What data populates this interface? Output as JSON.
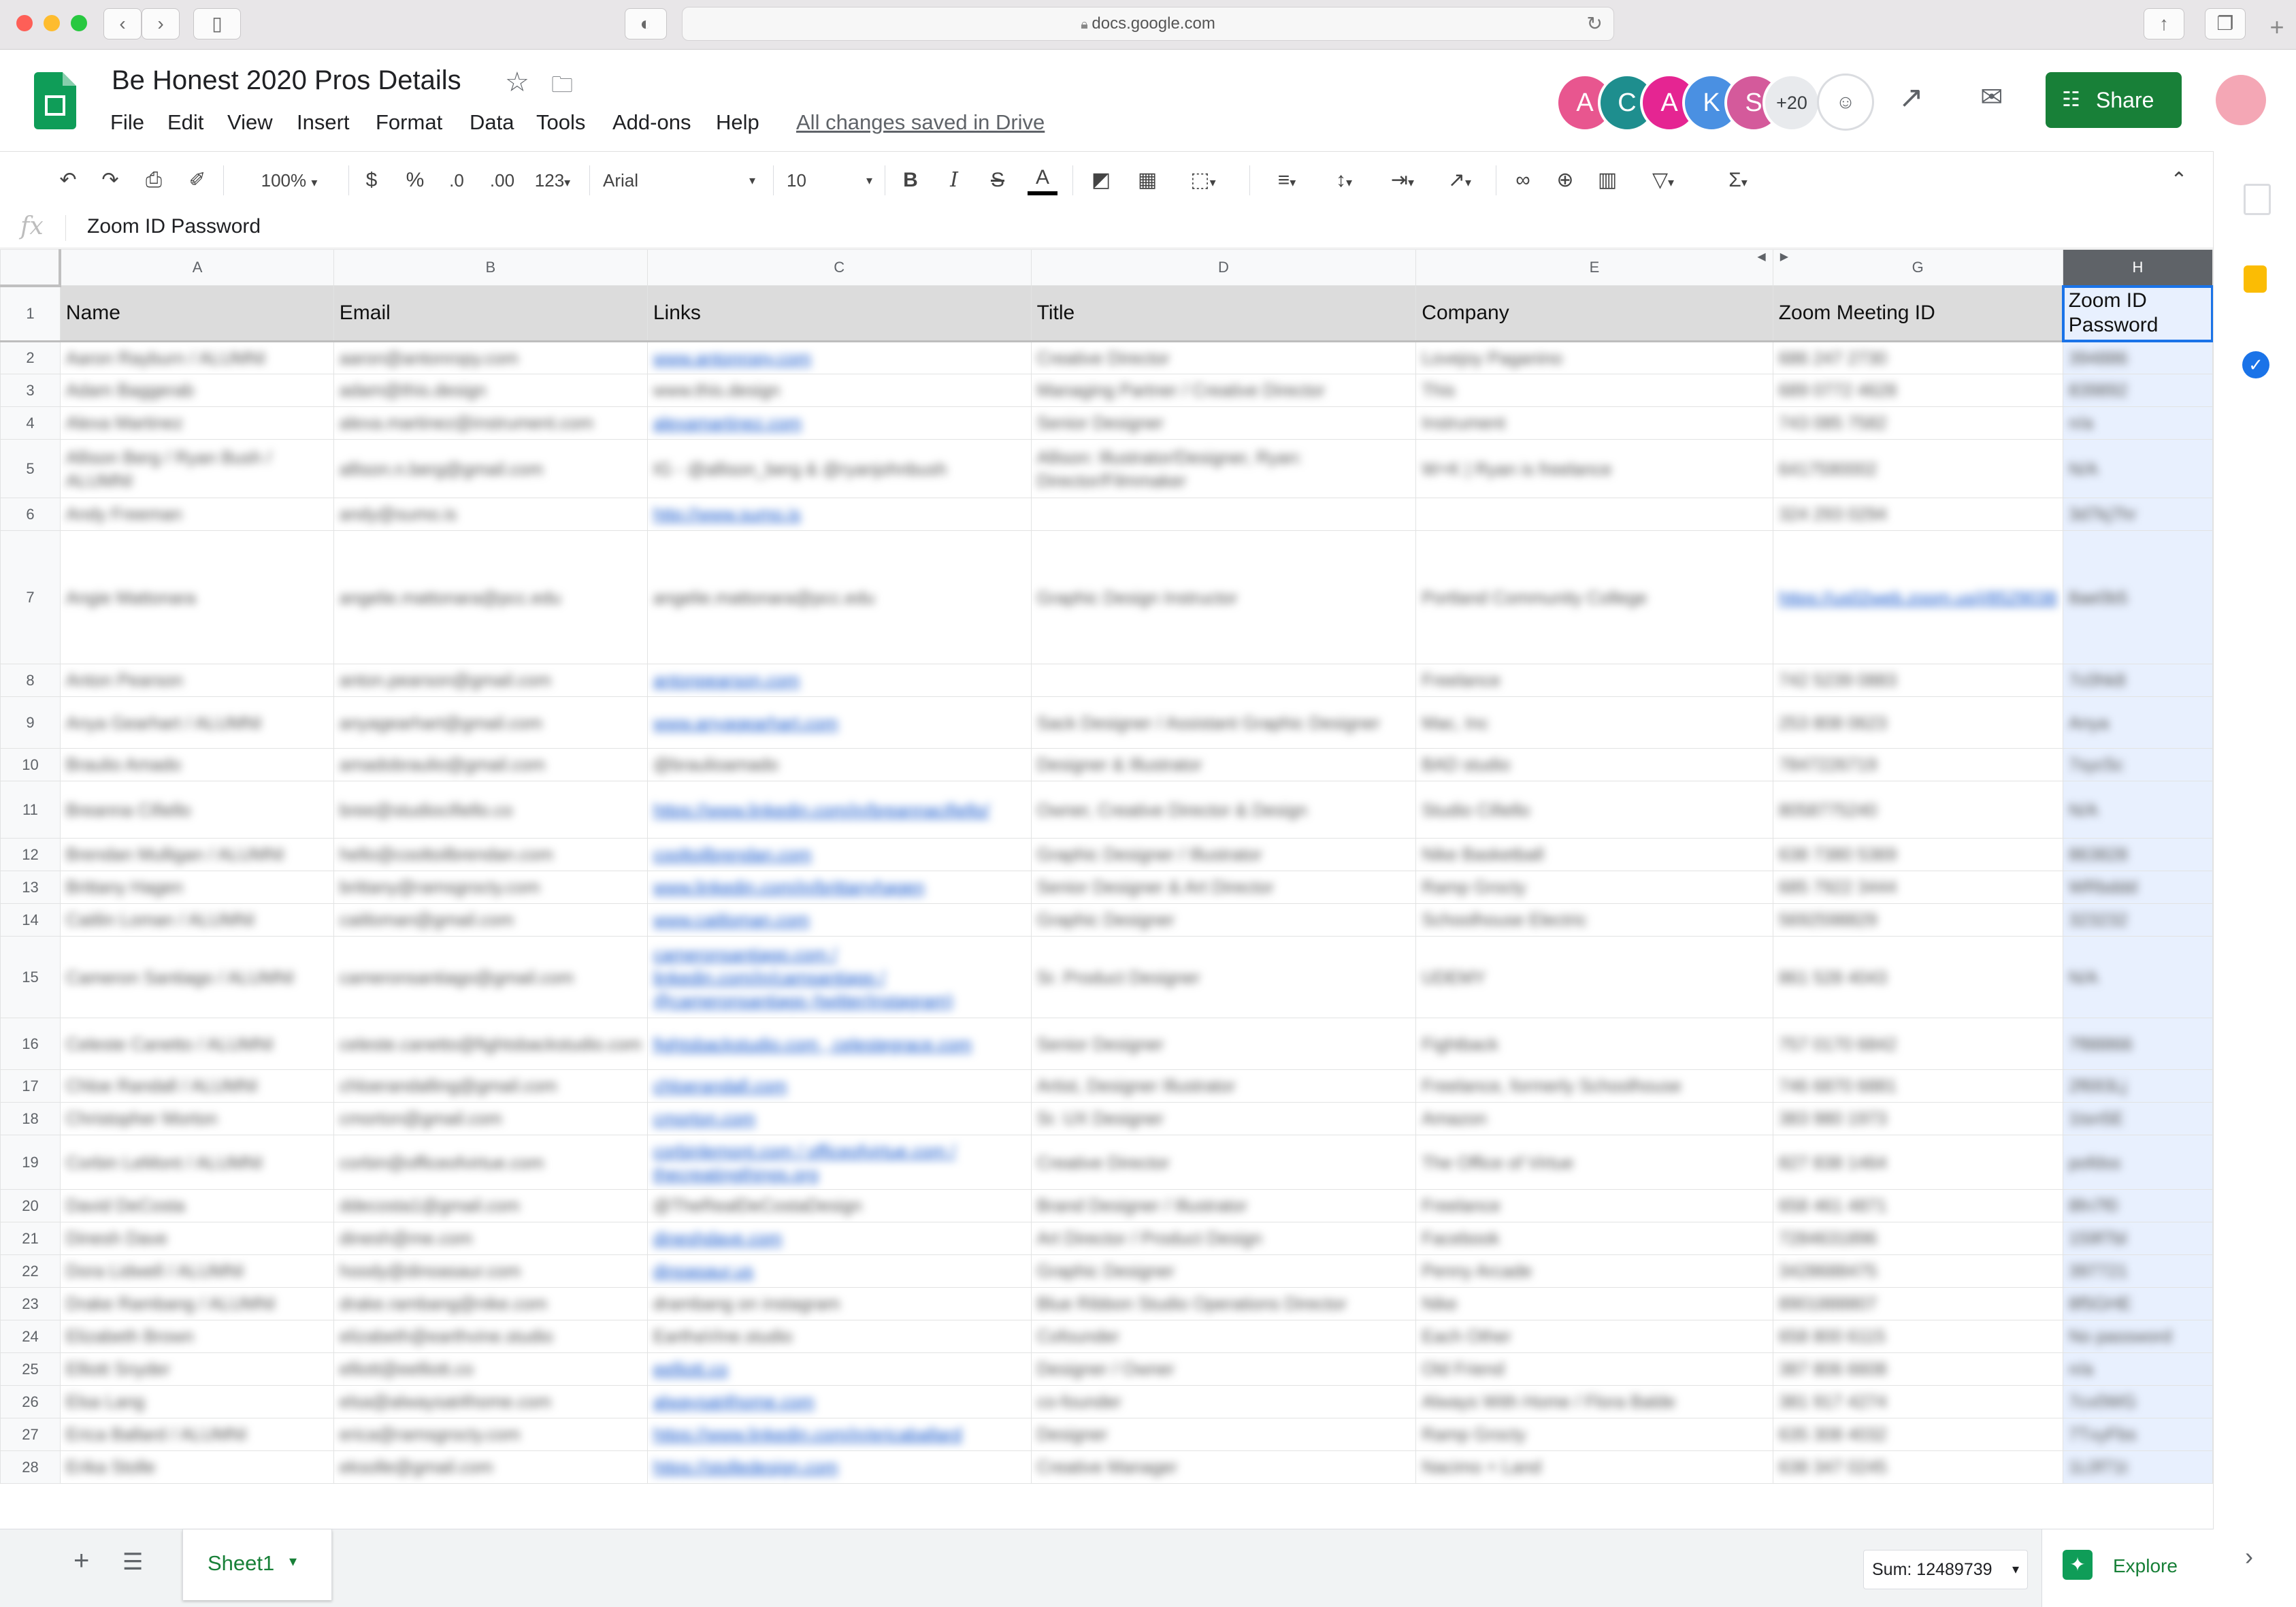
{
  "browser": {
    "url": "docs.google.com",
    "back_icon": "chevron-left-icon",
    "forward_icon": "chevron-right-icon"
  },
  "doc": {
    "title": "Be Honest 2020 Pros Details",
    "save_status": "All changes saved in Drive",
    "menu": [
      "File",
      "Edit",
      "View",
      "Insert",
      "Format",
      "Data",
      "Tools",
      "Add-ons",
      "Help"
    ]
  },
  "collaborators": {
    "avatars": [
      {
        "letter": "A",
        "color": "#e8568f"
      },
      {
        "letter": "C",
        "color": "#1e8e8e"
      },
      {
        "letter": "A",
        "color": "#e52592"
      },
      {
        "letter": "K",
        "color": "#4a90e2"
      },
      {
        "letter": "S",
        "color": "#d45a9b"
      }
    ],
    "more": "+20"
  },
  "share_label": "Share",
  "toolbar": {
    "zoom": "100%",
    "currency": "$",
    "percent": "%",
    "dec_decrease": ".0",
    "dec_increase": ".00",
    "more_formats": "123",
    "font": "Arial",
    "font_size": "10",
    "bold": "B",
    "italic": "I",
    "strike": "S",
    "text_color": "A"
  },
  "formula": {
    "fx": "fx",
    "value": "Zoom ID Password"
  },
  "grid": {
    "columns": [
      "A",
      "B",
      "C",
      "D",
      "E",
      "G",
      "H"
    ],
    "headers": [
      "Name",
      "Email",
      "Links",
      "Title",
      "Company",
      "Zoom Meeting ID",
      "Zoom ID\nPassword"
    ],
    "rows": [
      {
        "n": "2",
        "h": 48,
        "c": [
          "Aaron Rayburn / ALUMNI",
          "aaron@antonropy.com",
          "www.antonropy.com",
          "Creative Director",
          "Lovejoy Paganino",
          "686 247 2730",
          "394886"
        ],
        "links": [
          2
        ]
      },
      {
        "n": "3",
        "h": 48,
        "c": [
          "Adam Baggerab",
          "adam@this.design",
          "www.this.design",
          "Managing Partner / Creative Director",
          "This",
          "689 0772 4628",
          "839892"
        ],
        "links": []
      },
      {
        "n": "4",
        "h": 48,
        "c": [
          "Alexa Martinez",
          "alexa.martinez@instrument.com",
          "alexamartinez.com",
          "Senior Designer",
          "Instrument",
          "743 085 7582",
          "n/a"
        ],
        "links": [
          2
        ]
      },
      {
        "n": "5",
        "h": 86,
        "c": [
          "Allison Berg / Ryan Bush / ALUMNI",
          "allison.n.berg@gmail.com",
          "IG - @allison_berg & @ryanjohnbush",
          "Allison: Illustrator/Designer, Ryan: Director/Filmmaker",
          "W+K | Ryan is freelance",
          "6417590002",
          "N/A"
        ],
        "links": []
      },
      {
        "n": "6",
        "h": 48,
        "c": [
          "Andy Freeman",
          "andy@sumo.is",
          "http://www.sumo.is",
          "",
          "",
          "324 293 0294",
          "3d7kj7hr"
        ],
        "links": [
          2
        ]
      },
      {
        "n": "7",
        "h": 196,
        "c": [
          "Angie Mattonara",
          "angelie.mattonara@pcc.edu",
          "angelie.mattonara@pcc.edu",
          "Graphic Design Instructor",
          "Portland Community College",
          "https://us02web.zoom.us/j/8529038",
          "8ae0b5"
        ],
        "links": [
          5
        ]
      },
      {
        "n": "8",
        "h": 48,
        "c": [
          "Anton Pearson",
          "anton.pearson@gmail.com",
          "antonpearson.com",
          "",
          "Freelance",
          "742 5239 0883",
          "7c0hk8"
        ],
        "links": [
          2
        ]
      },
      {
        "n": "9",
        "h": 76,
        "c": [
          "Anya Gearhart / ALUMNI",
          "anyagearhart@gmail.com",
          "www.anyagearhart.com",
          "Sack Designer / Assistant Graphic Designer",
          "Mac, Inc",
          "253 808 0623",
          "Anya"
        ],
        "links": [
          2
        ]
      },
      {
        "n": "10",
        "h": 48,
        "c": [
          "Braulio Amado",
          "amadobraulio@gmail.com",
          "@braulioamado",
          "Designer & Illustrator",
          "BAD studio",
          "7847226719",
          "7syc5c"
        ],
        "links": []
      },
      {
        "n": "11",
        "h": 84,
        "c": [
          "Breanna Cifiello",
          "bree@studiocifiello.co",
          "https://www.linkedin.com/in/breannacifiello/",
          "Owner, Creative Director & Design",
          "Studio Cifiello",
          "8058775240",
          "N/A"
        ],
        "links": [
          2
        ]
      },
      {
        "n": "12",
        "h": 48,
        "c": [
          "Brendan Mulligan / ALUMNI",
          "hello@cooltoilbrendan.com",
          "cooltoilbrendan.com",
          "Graphic Designer / Illustrator",
          "Nike Basketball",
          "638 7380 5369",
          "863828"
        ],
        "links": [
          2
        ]
      },
      {
        "n": "13",
        "h": 48,
        "c": [
          "Brittany Hagen",
          "brittany@ramsgrocty.com",
          "www.linkedin.com/in/brittanyhagen",
          "Senior Designer & Art Director",
          "Ramp Grocty",
          "685 7922 3444",
          "WRbddd"
        ],
        "links": [
          2
        ]
      },
      {
        "n": "14",
        "h": 48,
        "c": [
          "Caitlin Loman / ALUMNI",
          "caitloman@gmail.com",
          "www.caitloman.com",
          "Graphic Designer",
          "Schoolhouse Electric",
          "5692598829",
          "323232"
        ],
        "links": [
          2
        ]
      },
      {
        "n": "15",
        "h": 120,
        "c": [
          "Cameron Santiago / ALUMNI",
          "cameronsantiago@gmail.com",
          "cameronsantiago.com / linkedin.com/in/camsantiago / @cameronsantiago (twitter/instagram)",
          "Sr. Product Designer",
          "UDEMY",
          "861 528 4043",
          "N/A"
        ],
        "links": [
          2
        ]
      },
      {
        "n": "16",
        "h": 76,
        "c": [
          "Celeste Canetto / ALUMNI",
          "celeste.canetto@fightsbackstudio.com",
          "fightsbackstudio.com , celestegrace.com",
          "Senior Designer",
          "Fightback",
          "757 0170 6842",
          "7f88866"
        ],
        "links": [
          2
        ]
      },
      {
        "n": "17",
        "h": 48,
        "c": [
          "Chloe Randall / ALUMNI",
          "chloerandalling@gmail.com",
          "chloerandall.com",
          "Artist, Designer Illustrator",
          "Freelance, formerly Schoolhouse",
          "746 6870 6881",
          "2f693Lj"
        ],
        "links": [
          2
        ]
      },
      {
        "n": "18",
        "h": 48,
        "c": [
          "Christopher Morton",
          "cmorton@gmail.com",
          "cmorton.com",
          "Sr. UX Designer",
          "Amazon",
          "383 980 1973",
          "1tsn5E"
        ],
        "links": [
          2
        ]
      },
      {
        "n": "19",
        "h": 80,
        "c": [
          "Corbin LeMont / ALUMNI",
          "corbin@officeofvirtue.com",
          "corbinlemont.com / officeofvirtue.com / thecreatingthings.org",
          "Creative Director",
          "The Office of Virtue",
          "827 838 1464",
          "pofdss"
        ],
        "links": [
          2
        ]
      },
      {
        "n": "20",
        "h": 48,
        "c": [
          "David DeCosta",
          "ddecosta1@gmail.com",
          "@TheRealDeCostaDesign",
          "Brand Designer / Illustrator",
          "Freelance",
          "658 461 4871",
          "8fn7f0"
        ],
        "links": []
      },
      {
        "n": "21",
        "h": 48,
        "c": [
          "Dinesh Dave",
          "dinesh@me.com",
          "dineshdave.com",
          "Art Director / Product Design",
          "Facebook",
          "7284631896",
          "159f7bl"
        ],
        "links": [
          2
        ]
      },
      {
        "n": "22",
        "h": 48,
        "c": [
          "Dora Lidwell / ALUMNI",
          "hoody@dinoasaur.com",
          "dinoasaur.us",
          "Graphic Designer",
          "Penny Arcade",
          "3428688475",
          "397721"
        ],
        "links": [
          2
        ]
      },
      {
        "n": "23",
        "h": 48,
        "c": [
          "Drake Rambang / ALUMNI",
          "drake.rambang@nike.com",
          "drambang on instagram",
          "Blue Ribbon Studio Operations Director",
          "Nike",
          "8901888807",
          "8f5GHE"
        ],
        "links": []
      },
      {
        "n": "24",
        "h": 48,
        "c": [
          "Elizabeth Brown",
          "elizabeth@earthvine.studio",
          "EarthaVine.studio",
          "Cofounder",
          "Each Other",
          "658 800 6115",
          "No password"
        ],
        "links": []
      },
      {
        "n": "25",
        "h": 48,
        "c": [
          "Elliott Snyder",
          "elliott@eelliott.co",
          "eelliott.co",
          "Designer / Owner",
          "Old Friend",
          "387 806 6608",
          "n/a"
        ],
        "links": [
          2
        ]
      },
      {
        "n": "26",
        "h": 48,
        "c": [
          "Elsa Lang",
          "elsa@alwaysat4home.com",
          "alwaysat4home.com",
          "co-founder",
          "Always With Home / Flora Balde",
          "381 917 4274",
          "7cv0WG"
        ],
        "links": [
          2
        ]
      },
      {
        "n": "27",
        "h": 48,
        "c": [
          "Erica Ballard / ALUMNI",
          "erica@ramsgrocty.com",
          "https://www.linkedin.com/in/ericaballard",
          "Designer",
          "Ramp Grocty",
          "635 308 4032",
          "7TxyFbs"
        ],
        "links": [
          2
        ]
      },
      {
        "n": "28",
        "h": 48,
        "c": [
          "Erika Stolle",
          "eksolle@gmail.com",
          "https://stolledesign.com",
          "Creative Manager",
          "Nacimo + Land",
          "638 347 0245",
          "1L0f71t"
        ],
        "links": [
          2
        ]
      }
    ]
  },
  "bottom": {
    "add_sheet": "+",
    "sheet_name": "Sheet1",
    "sum": "Sum: 12489739",
    "explore": "Explore"
  }
}
